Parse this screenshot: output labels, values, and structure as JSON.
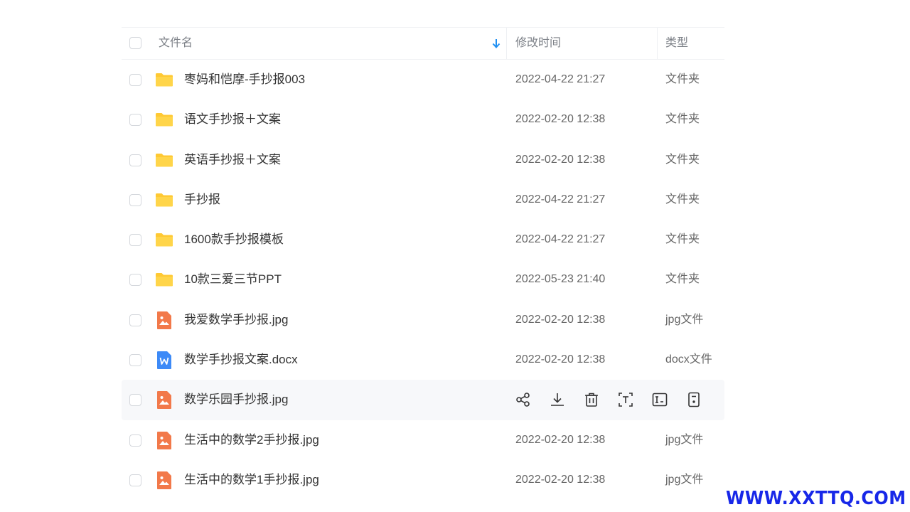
{
  "header": {
    "name_col": "文件名",
    "modified_col": "修改时间",
    "type_col": "类型"
  },
  "files": [
    {
      "name": "枣妈和恺摩-手抄报003",
      "date": "2022-04-22 21:27",
      "type": "文件夹",
      "kind": "folder"
    },
    {
      "name": "语文手抄报＋文案",
      "date": "2022-02-20 12:38",
      "type": "文件夹",
      "kind": "folder"
    },
    {
      "name": "英语手抄报＋文案",
      "date": "2022-02-20 12:38",
      "type": "文件夹",
      "kind": "folder"
    },
    {
      "name": "手抄报",
      "date": "2022-04-22 21:27",
      "type": "文件夹",
      "kind": "folder"
    },
    {
      "name": "1600款手抄报模板",
      "date": "2022-04-22 21:27",
      "type": "文件夹",
      "kind": "folder"
    },
    {
      "name": "10款三爱三节PPT",
      "date": "2022-05-23 21:40",
      "type": "文件夹",
      "kind": "folder"
    },
    {
      "name": "我爱数学手抄报.jpg",
      "date": "2022-02-20 12:38",
      "type": "jpg文件",
      "kind": "image"
    },
    {
      "name": "数学手抄报文案.docx",
      "date": "2022-02-20 12:38",
      "type": "docx文件",
      "kind": "word"
    },
    {
      "name": "数学乐园手抄报.jpg",
      "date": "",
      "type": "",
      "kind": "image",
      "hovered": true
    },
    {
      "name": "生活中的数学2手抄报.jpg",
      "date": "2022-02-20 12:38",
      "type": "jpg文件",
      "kind": "image"
    },
    {
      "name": "生活中的数学1手抄报.jpg",
      "date": "2022-02-20 12:38",
      "type": "jpg文件",
      "kind": "image"
    }
  ],
  "hover_actions": [
    "share-icon",
    "download-icon",
    "delete-icon",
    "text-recognize-icon",
    "rename-icon",
    "more-icon"
  ],
  "icons": {
    "sort": "sort-down-icon",
    "folder": "folder-icon",
    "image": "image-file-icon",
    "word": "word-file-icon"
  },
  "colors": {
    "folder": "#ffc933",
    "image": "#f2794a",
    "word": "#3d8af7",
    "sort": "#1f8ff2",
    "watermark": "#1727e8"
  },
  "watermark": "WWW.XXTTQ.COM"
}
